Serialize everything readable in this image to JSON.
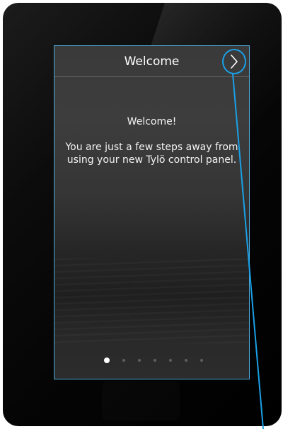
{
  "header": {
    "title": "Welcome",
    "next_icon": "chevron-right-icon"
  },
  "content": {
    "headline": "Welcome!",
    "body": "You are just a few steps away from using your new Tylö control panel."
  },
  "pagination": {
    "total": 7,
    "current": 1
  },
  "colors": {
    "highlight": "#1aa0e6",
    "screen_border": "#4aa8d8"
  }
}
